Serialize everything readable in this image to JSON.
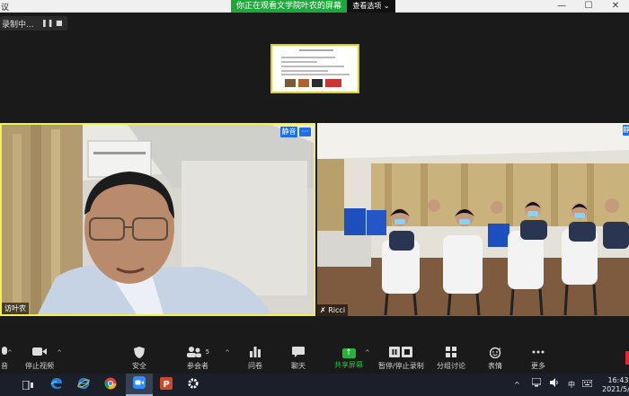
{
  "window": {
    "title": "议",
    "controls": [
      "—",
      "☐",
      "✕"
    ]
  },
  "share_banner": {
    "text": "你正在观看文学院叶农的屏幕",
    "view_options": "查看选项 ⌄"
  },
  "recording": {
    "status": "录制中...",
    "pause": "❚❚",
    "stop": "■"
  },
  "tiles": {
    "left": {
      "name": "叶农",
      "name_visible": "访叶农",
      "mute_badge": "静音",
      "more": "···"
    },
    "right": {
      "name": "Ricci",
      "mute_badge": "静"
    }
  },
  "toolbar": {
    "items": [
      {
        "id": "mute",
        "label": "音",
        "icon": "mic-icon"
      },
      {
        "id": "video",
        "label": "停止视频",
        "icon": "video-camera-icon"
      },
      {
        "id": "security",
        "label": "安全",
        "icon": "shield-icon"
      },
      {
        "id": "participants",
        "label": "参会者",
        "icon": "participants-icon",
        "count": "5"
      },
      {
        "id": "polls",
        "label": "问卷",
        "icon": "bar-chart-icon"
      },
      {
        "id": "chat",
        "label": "聊天",
        "icon": "chat-bubble-icon"
      },
      {
        "id": "share",
        "label": "共享屏幕",
        "icon": "share-screen-icon"
      },
      {
        "id": "pause-share",
        "label": "暂停/停止录制",
        "icon": "pause-stop-icon"
      },
      {
        "id": "breakout",
        "label": "分组讨论",
        "icon": "breakout-grid-icon"
      },
      {
        "id": "reactions",
        "label": "表情",
        "icon": "emoji-icon"
      },
      {
        "id": "more",
        "label": "更多",
        "icon": "ellipsis-icon"
      }
    ]
  },
  "taskbar": {
    "apps": [
      "task-view-icon",
      "edge-icon",
      "ie-icon",
      "chrome-icon",
      "zoom-icon",
      "powerpoint-icon",
      "settings-icon"
    ],
    "tray": {
      "chevron": "^",
      "ime": "中",
      "clock_time": "16:43",
      "clock_date": "2021/5/6"
    }
  },
  "colors": {
    "share_green": "#1ea83c",
    "active_speaker": "#f2f04a",
    "badge_blue": "#1c6fe8",
    "end_red": "#e0282e"
  }
}
